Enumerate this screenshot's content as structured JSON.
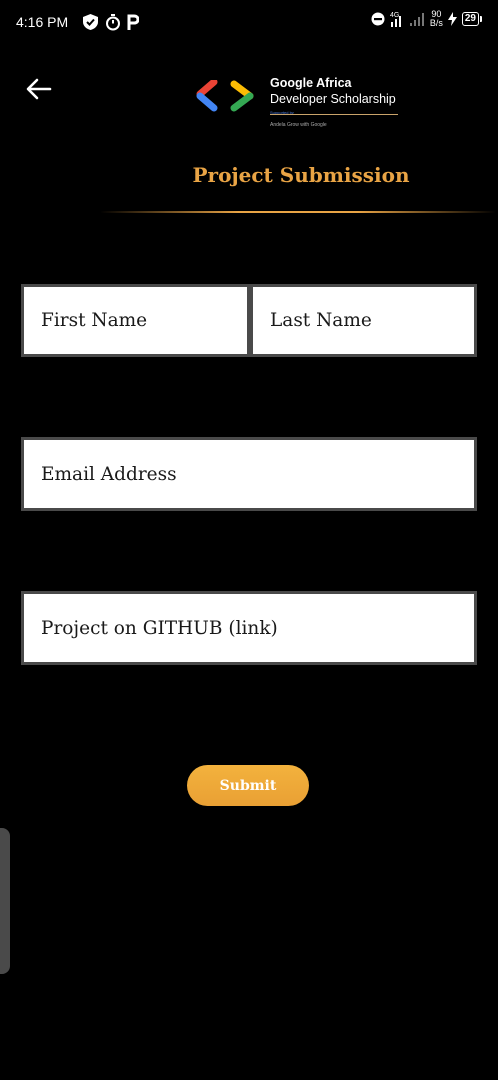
{
  "status_bar": {
    "time": "4:16 PM",
    "left_icons": [
      "shield-check-icon",
      "stopwatch-icon",
      "parking-icon"
    ],
    "right_icons": [
      "do-not-disturb-icon",
      "signal-4g-icon",
      "signal-bars-icon"
    ],
    "network_speed_top": "90",
    "network_speed_bottom": "B/s",
    "battery_level": "29"
  },
  "header": {
    "back_icon": "arrow-left-icon",
    "brand_line1": "Google Africa",
    "brand_line2": "Developer Scholarship",
    "brand_supported": "Supported by",
    "brand_partners": "Andela   Grow with Google",
    "title": "Project Submission"
  },
  "form": {
    "first_name_placeholder": "First Name",
    "last_name_placeholder": "Last Name",
    "email_placeholder": "Email Address",
    "github_placeholder": "Project on GITHUB (link)",
    "submit_label": "Submit"
  },
  "colors": {
    "accent": "#e9a445",
    "background": "#000000",
    "field_border": "#4a4a4a"
  }
}
